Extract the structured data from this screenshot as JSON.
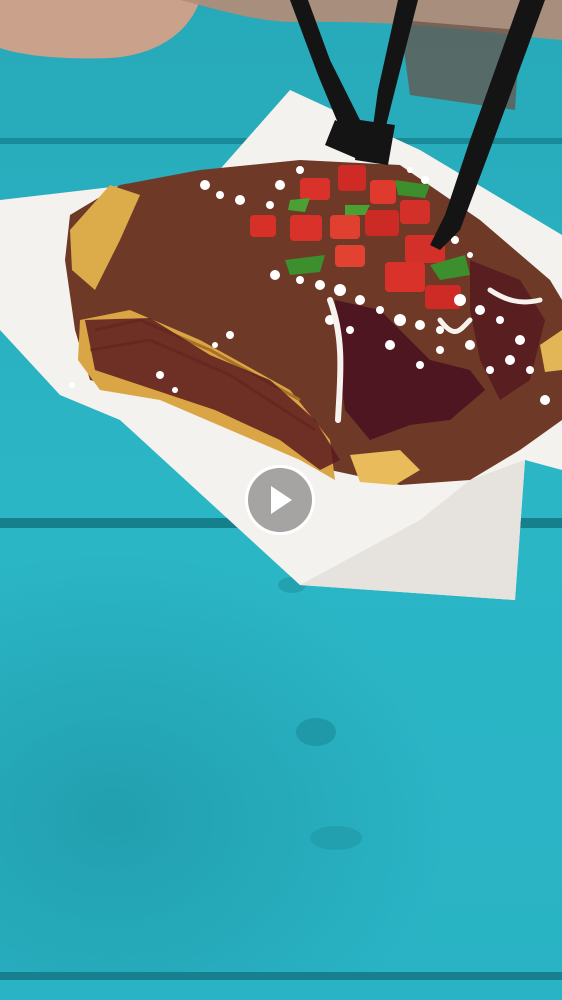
{
  "photo": {
    "subject": "food-photo",
    "colors": {
      "table": "#2bb6c6",
      "table_dark": "#1f9aa9",
      "paper": "#f4f2ee",
      "sauce": "#5b1a1f",
      "fries": "#d9a545",
      "tomato": "#d8322a",
      "cheese": "#ffffff",
      "cilantro": "#3c8f2c",
      "forks": "#141414"
    }
  },
  "video": {
    "play_icon": "play-icon",
    "play_button_color": "#ffffff"
  }
}
